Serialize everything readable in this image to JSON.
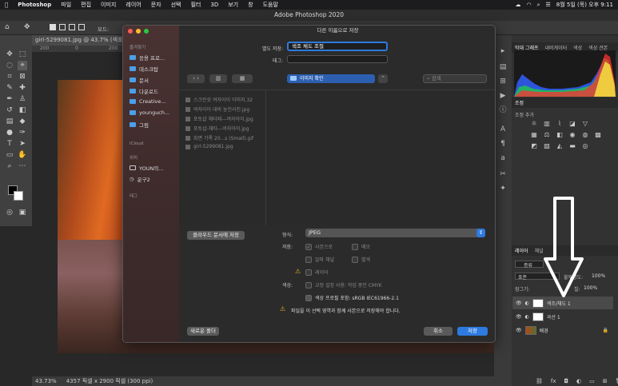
{
  "menubar": {
    "app": "Photoshop",
    "items": [
      "파일",
      "편집",
      "이미지",
      "레이어",
      "문자",
      "선택",
      "필터",
      "3D",
      "보기",
      "창",
      "도움말"
    ],
    "clock": "8월 5일 (목) 오후 9:11"
  },
  "window_title": "Adobe Photoshop 2020",
  "document_tab": "girl-5299081.jpg @ 43.7% (색조",
  "options_bar": {
    "mode_label": "모드:"
  },
  "status_bar": {
    "zoom": "43.73%",
    "info": "4357 픽셀 x 2900 픽셀 (300 ppi)"
  },
  "ruler": {
    "ticks": [
      "200",
      "0",
      "200"
    ]
  },
  "dialog": {
    "title": "다른 이름으로 저장",
    "sidebar": {
      "favorites_label": "즐겨찾기",
      "favorites": [
        "응용 프로...",
        "데스크탑",
        "문서",
        "다운로드",
        "Creative...",
        "younguch...",
        "그림"
      ],
      "icloud_label": "iCloud",
      "locations_label": "위치",
      "locations": [
        "YOUN의...",
        "운구2"
      ],
      "tags_label": "태그"
    },
    "save_as_label": "별도 저장:",
    "save_as_value": "색조 채도 조절",
    "tags_field_label": "태그:",
    "folder": "이미지 확인",
    "search_placeholder": "검색",
    "files": [
      "스크린샷 여자아이 이미지.32",
      "여자아이 대비 높인사진.jpg",
      "포토샵 채터때---여자아이.jpg",
      "포토샵-채타---여자아이.jpg",
      "화면 기록 20...s (Small).gif",
      "girl-5299081.jpg"
    ],
    "cloud_button": "클라우드 문서에 저장",
    "format_label": "형식:",
    "format_value": "JPEG",
    "save_label": "저장:",
    "options": {
      "copy": "사본으로",
      "notes": "메모",
      "alpha": "알파 채널",
      "spot": "별색",
      "layers": "레이어"
    },
    "color_label": "색상:",
    "proof": "교정 설정 사용: 작업 중인 CMYK",
    "icc": "색상 프로필 포함: sRGB IEC61966-2.1",
    "warning": "파일을 이 선택 영역과 함께 사본으로 저장해야 합니다.",
    "new_folder": "새로운 폴더",
    "cancel": "취소",
    "save": "저장"
  },
  "panels": {
    "histogram_tabs": [
      "막대 그래프",
      "내비게이터",
      "색상",
      "색상 견본"
    ],
    "adjust_tab": "조정",
    "adjust_add": "조정 추가",
    "layer_tabs": [
      "레이어",
      "채널"
    ],
    "kind": "종류",
    "blend": "표준",
    "opacity_label": "불투명도:",
    "opacity": "100%",
    "lock_label": "잠그기:",
    "fill_label": "칠:",
    "fill": "100%",
    "layers": [
      "색조/채도 1",
      "곡선 1",
      "배경"
    ]
  },
  "colors": {
    "accent": "#2d7ae0",
    "menubar": "#1c1c1e"
  }
}
